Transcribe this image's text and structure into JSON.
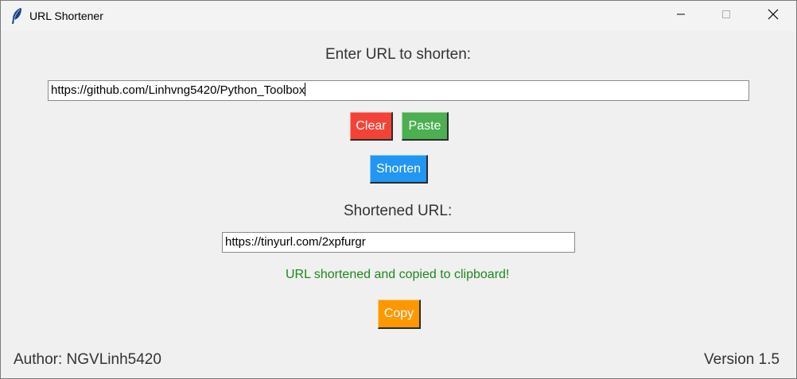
{
  "window": {
    "title": "URL Shortener",
    "icon": "feather-icon",
    "controls": [
      "minimize-icon",
      "maximize-icon",
      "close-icon"
    ]
  },
  "main": {
    "input_label": "Enter URL to shorten:",
    "input_value": "https://github.com/Linhvng5420/Python_Toolbox",
    "clear_label": "Clear",
    "paste_label": "Paste",
    "shorten_label": "Shorten",
    "output_label": "Shortened URL:",
    "output_value": "https://tinyurl.com/2xpfurgr",
    "status_message": "URL shortened and copied to clipboard!",
    "copy_label": "Copy"
  },
  "footer": {
    "author": "Author: NGVLinh5420",
    "version": "Version 1.5"
  },
  "colors": {
    "clear": "#f44336",
    "paste": "#4caf50",
    "shorten": "#2196f3",
    "copy": "#ff9800",
    "status": "#1a8a1a",
    "background": "#f0f0f0"
  }
}
